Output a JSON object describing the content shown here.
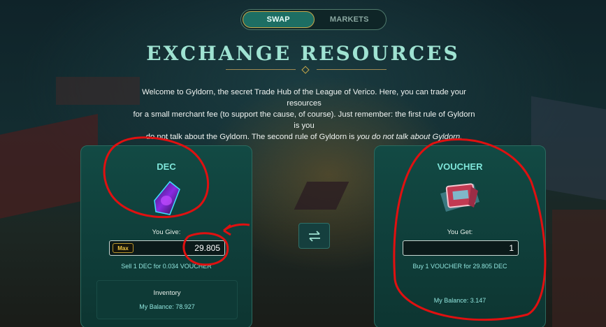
{
  "tabs": [
    {
      "label": "SWAP",
      "active": true
    },
    {
      "label": "MARKETS",
      "active": false
    }
  ],
  "page": {
    "title": "EXCHANGE RESOURCES",
    "intro_line1": "Welcome to Gyldorn, the secret Trade Hub of the League of Verico. Here, you can trade your resources",
    "intro_line2": "for a small merchant fee (to support the cause, of course). Just remember: the first rule of Gyldorn is you",
    "intro_line3a": "do not talk about the Gyldorn. The second rule of Gyldorn is ",
    "intro_line3b": "you do not talk about Gyldorn."
  },
  "give": {
    "resource": "DEC",
    "icon": "purple-crystal-icon",
    "label": "You Give:",
    "max_label": "Max",
    "value": "29.805",
    "rate": "Sell 1 DEC for 0.034 VOUCHER",
    "inventory_title": "Inventory",
    "balance": "My Balance: 78.927"
  },
  "get": {
    "resource": "VOUCHER",
    "icon": "voucher-icon",
    "label": "You Get:",
    "value": "1",
    "rate": "Buy 1 VOUCHER for 29.805 DEC",
    "balance": "My Balance: 3.147"
  },
  "swap_icon": "swap-arrows-icon",
  "colors": {
    "accent": "#7fe6da",
    "gold": "#c9a84a",
    "annotation": "#e01010"
  }
}
